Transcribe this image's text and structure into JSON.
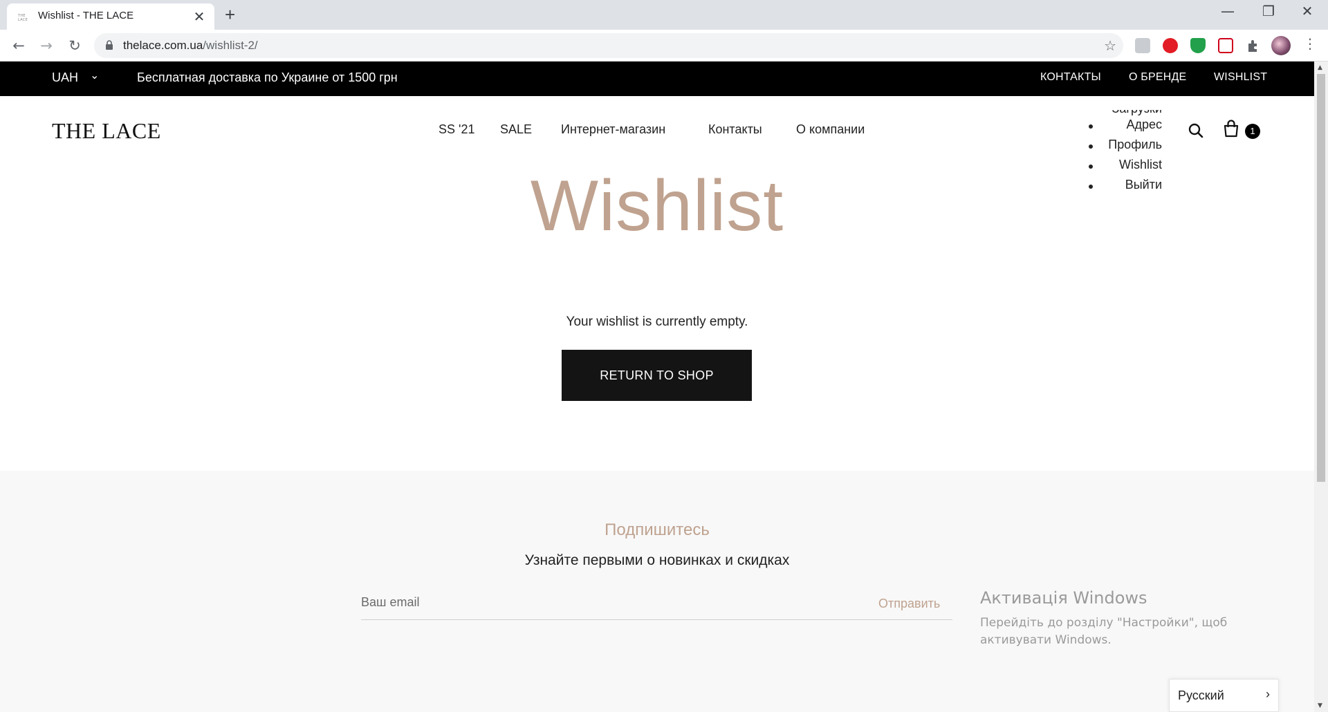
{
  "browser": {
    "tab_title": "Wishlist - THE LACE",
    "tab_favicon_text": "THE LACE",
    "tab_close": "✕",
    "new_tab": "+",
    "url_host": "thelace.com.ua",
    "url_path": "/wishlist-2/",
    "back": "←",
    "forward": "→",
    "reload": "↻",
    "star": "☆",
    "minimize": "—",
    "restore": "❐",
    "close": "✕",
    "menu": "⋮"
  },
  "topbar": {
    "currency": "UAH",
    "currency_chevron": "⌄",
    "promo": "Бесплатная доставка по Украине от 1500 грн",
    "links": [
      "КОНТАКТЫ",
      "О БРЕНДЕ",
      "WISHLIST"
    ]
  },
  "header": {
    "logo": "THE LACE",
    "nav": [
      "SS '21",
      "SALE",
      "Интернет-магазин",
      "Контакты",
      "О компании"
    ],
    "account_menu": [
      "Загрузки",
      "Адрес",
      "Профиль",
      "Wishlist",
      "Выйти"
    ],
    "cart_count": "1"
  },
  "main": {
    "title": "Wishlist",
    "empty_message": "Your wishlist is currently empty.",
    "return_button": "RETURN TO SHOP"
  },
  "subscribe": {
    "title": "Подпишитесь",
    "text": "Узнайте первыми о новинках и скидках",
    "email_placeholder": "Ваш email",
    "send_label": "Отправить"
  },
  "windows_overlay": {
    "title": "Активація Windows",
    "text": "Перейдіть до розділу \"Настройки\", щоб активувати Windows."
  },
  "language": {
    "label": "Русский",
    "chevron": "›"
  }
}
